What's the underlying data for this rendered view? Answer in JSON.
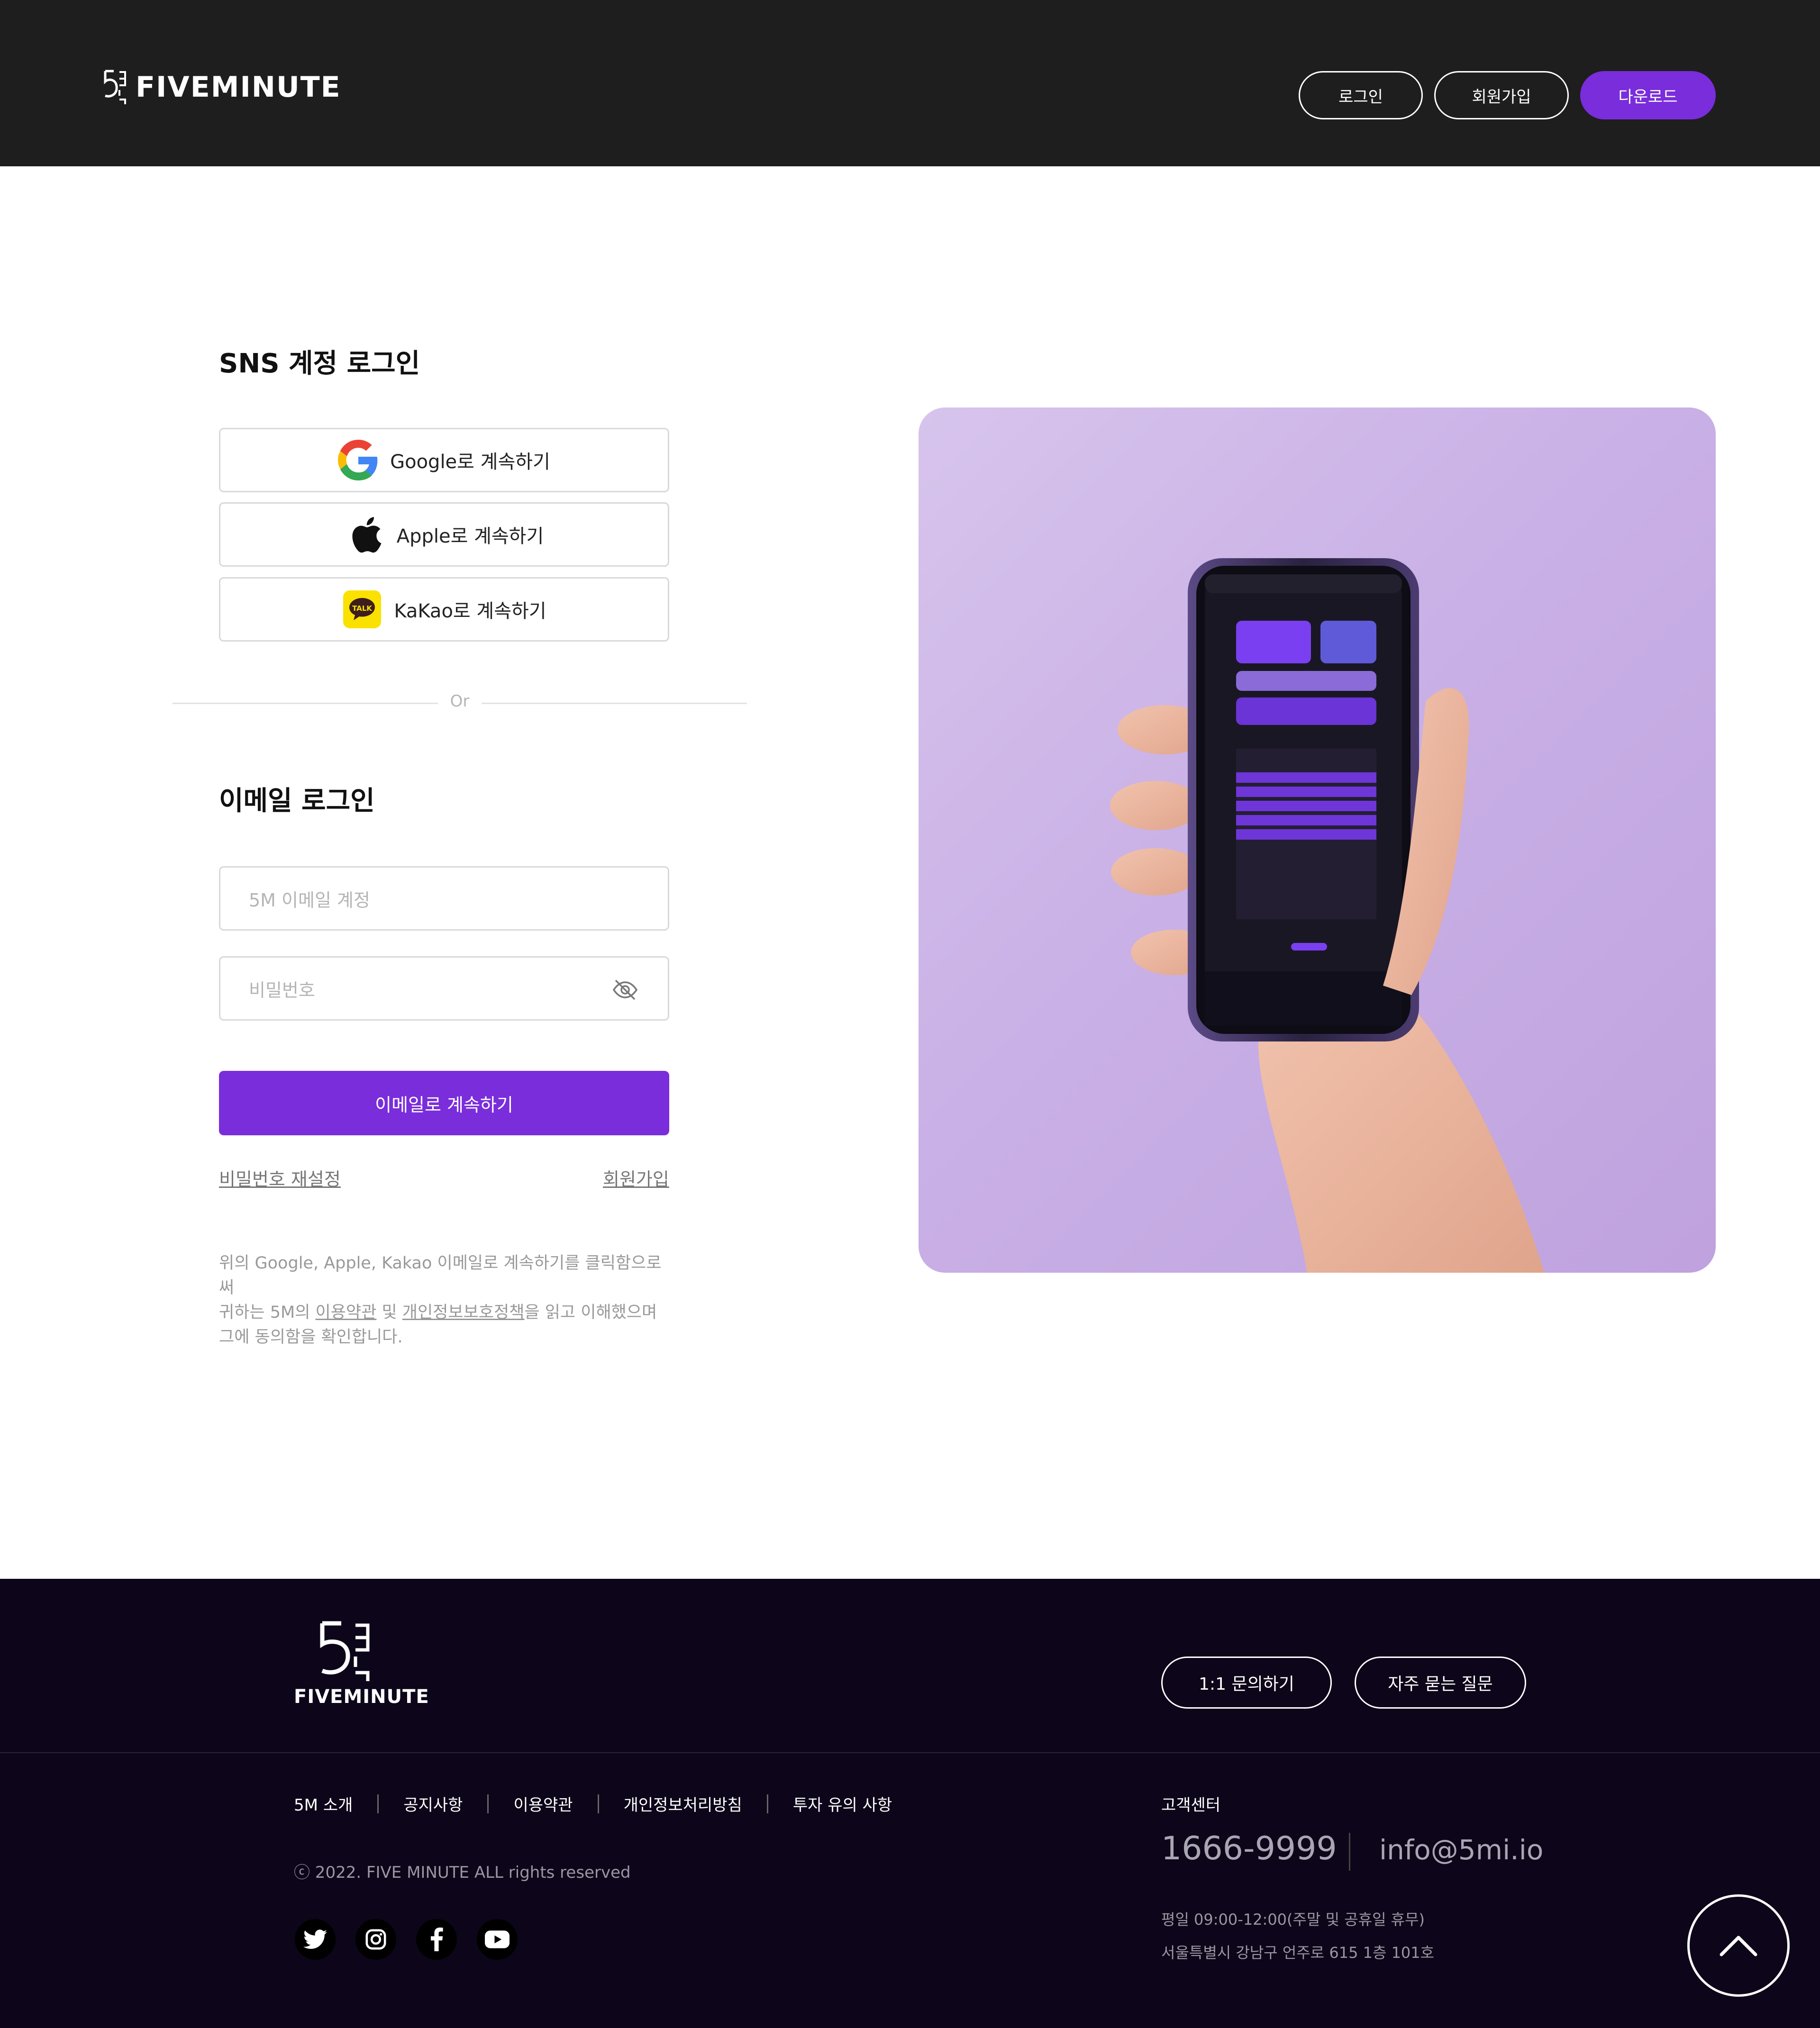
{
  "header": {
    "brand": "FIVEMINUTE",
    "login_label": "로그인",
    "signup_label": "회원가입",
    "download_label": "다운로드"
  },
  "sns": {
    "title": "SNS 계정 로그인",
    "google_label": "Google로 계속하기",
    "apple_label": "Apple로 계속하기",
    "kakao_label": "KaKao로 계속하기",
    "kakao_icon_text": "TALK"
  },
  "divider": {
    "text": "Or"
  },
  "email": {
    "title": "이메일 로그인",
    "email_placeholder": "5M 이메일 계정",
    "password_placeholder": "비밀번호",
    "submit_label": "이메일로 계속하기",
    "reset_password_label": "비밀번호 재설정",
    "signup_label": "회원가입"
  },
  "notice": {
    "line1": "위의 Google, Apple, Kakao 이메일로 계속하기를 클릭함으로써",
    "line2_prefix": "귀하는 5M의 ",
    "terms_link": "이용약관",
    "line2_mid": " 및 ",
    "privacy_link": "개인정보보호정책",
    "line2_suffix": "을 읽고 이해했으며",
    "line3": "그에 동의함을 확인합니다."
  },
  "footer": {
    "brand": "FIVEMINUTE",
    "inquiry_label": "1:1 문의하기",
    "faq_label": "자주 묻는 질문",
    "nav": [
      "5M 소개",
      "공지사항",
      "이용약관",
      "개인정보처리방침",
      "투자 유의 사항"
    ],
    "copyright": "ⓒ 2022. FIVE MINUTE ALL rights reserved",
    "cs_label": "고객센터",
    "phone": "1666-9999",
    "email": "info@5mi.io",
    "hours": "평일 09:00-12:00(주말 및 공휴일 휴무)",
    "address": "서울특별시 강남구 언주로 615 1층 101호"
  },
  "colors": {
    "header_bg": "#1e1e1e",
    "accent_purple": "#7a2ddb",
    "footer_bg": "#0d0519",
    "hero_bg": "#c9b0e6",
    "kakao_yellow": "#fae100"
  },
  "icons": [
    "google-icon",
    "apple-icon",
    "kakao-talk-icon",
    "eye-off-icon",
    "twitter-icon",
    "instagram-icon",
    "facebook-icon",
    "youtube-icon",
    "chevron-up-icon"
  ]
}
